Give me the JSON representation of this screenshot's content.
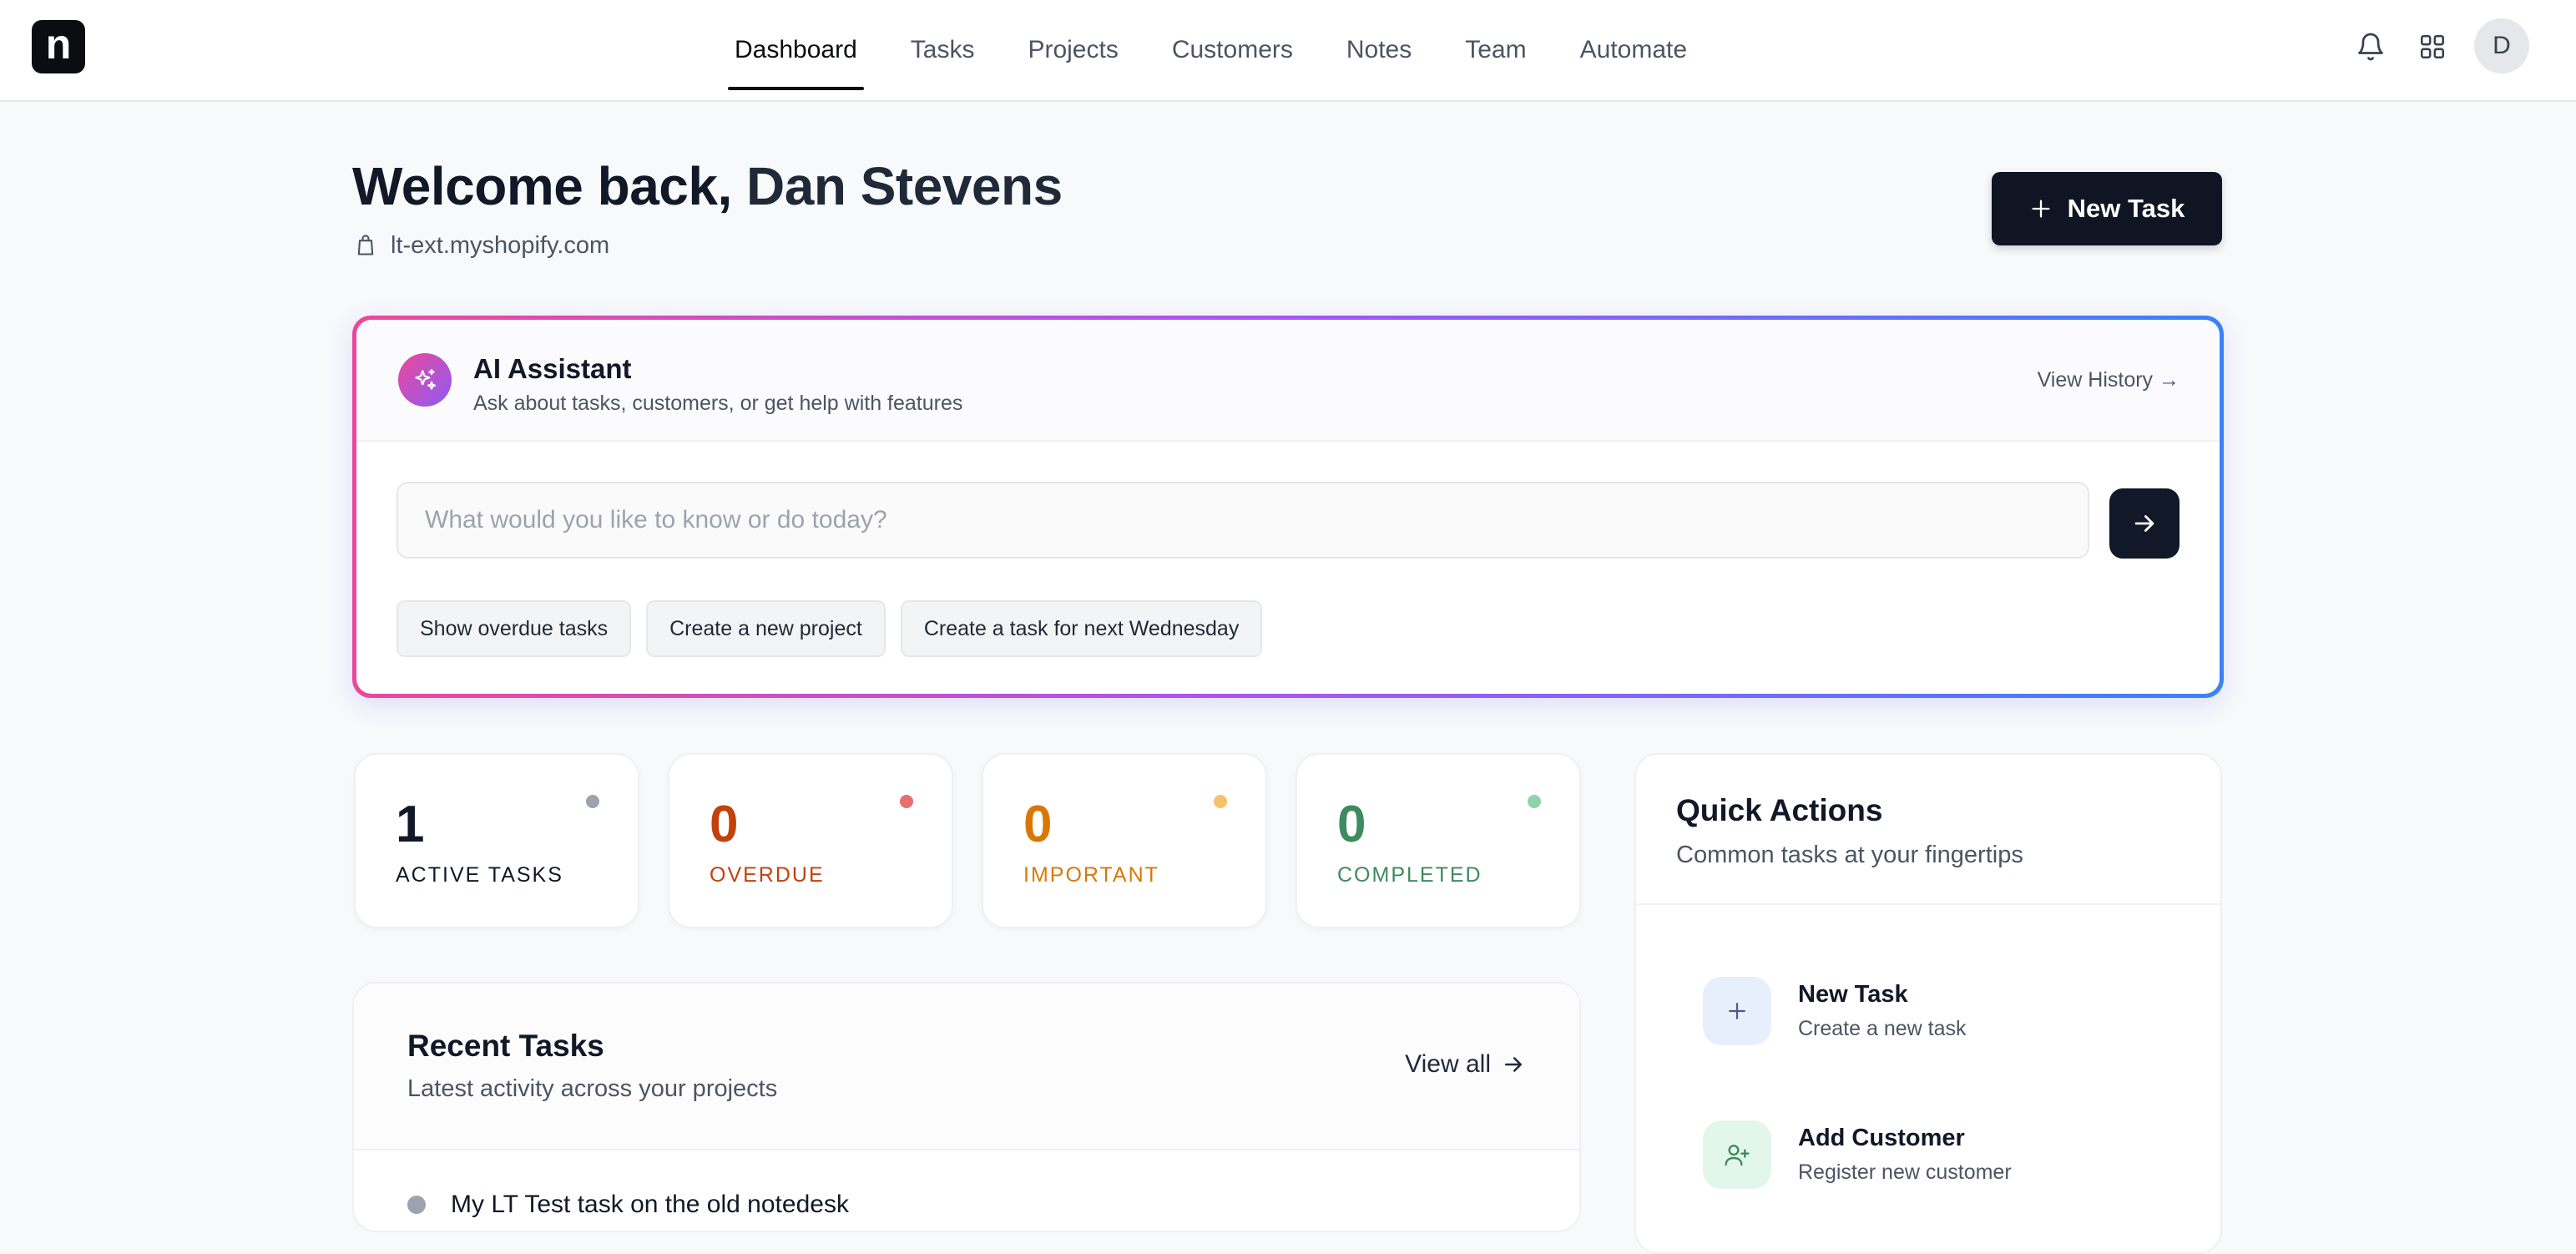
{
  "app": {
    "logo_letter": "n"
  },
  "nav": {
    "items": [
      {
        "label": "Dashboard",
        "active": true
      },
      {
        "label": "Tasks"
      },
      {
        "label": "Projects"
      },
      {
        "label": "Customers"
      },
      {
        "label": "Notes"
      },
      {
        "label": "Team"
      },
      {
        "label": "Automate"
      }
    ],
    "icons": [
      "bell-icon",
      "apps-grid-icon"
    ],
    "avatar_initial": "D"
  },
  "header": {
    "welcome_prefix": "Welcome back,",
    "user_name": "Dan Stevens",
    "shop_domain": "lt-ext.myshopify.com",
    "new_task_label": "New Task"
  },
  "ai_assistant": {
    "title": "AI Assistant",
    "subtitle": "Ask about tasks, customers, or get help with features",
    "view_history_label": "View History →",
    "input_placeholder": "What would you like to know or do today?",
    "input_value": "",
    "suggestions": [
      "Show overdue tasks",
      "Create a new project",
      "Create a task for next Wednesday"
    ],
    "gradient_colors": [
      "#ec4899",
      "#a855f7",
      "#3b82f6"
    ]
  },
  "stats": [
    {
      "value": "1",
      "label": "ACTIVE TASKS",
      "color": "#111827",
      "dot_color": "#9ca3af"
    },
    {
      "value": "0",
      "label": "OVERDUE",
      "color": "#c2410c",
      "dot_color": "#e76f6f"
    },
    {
      "value": "0",
      "label": "IMPORTANT",
      "color": "#d97706",
      "dot_color": "#f5c26b"
    },
    {
      "value": "0",
      "label": "COMPLETED",
      "color": "#3f8a5f",
      "dot_color": "#8fd4a8"
    }
  ],
  "recent_tasks": {
    "title": "Recent Tasks",
    "subtitle": "Latest activity across your projects",
    "view_all_label": "View all",
    "items": [
      {
        "title": "My LT Test task on the old notedesk"
      }
    ]
  },
  "quick_actions": {
    "title": "Quick Actions",
    "subtitle": "Common tasks at your fingertips",
    "items": [
      {
        "title": "New Task",
        "description": "Create a new task",
        "icon": "plus-icon",
        "icon_bg": "#e8effc",
        "icon_color": "#4b5a8a"
      },
      {
        "title": "Add Customer",
        "description": "Register new customer",
        "icon": "user-plus-icon",
        "icon_bg": "#e3f6ea",
        "icon_color": "#3f8a5f"
      }
    ]
  }
}
